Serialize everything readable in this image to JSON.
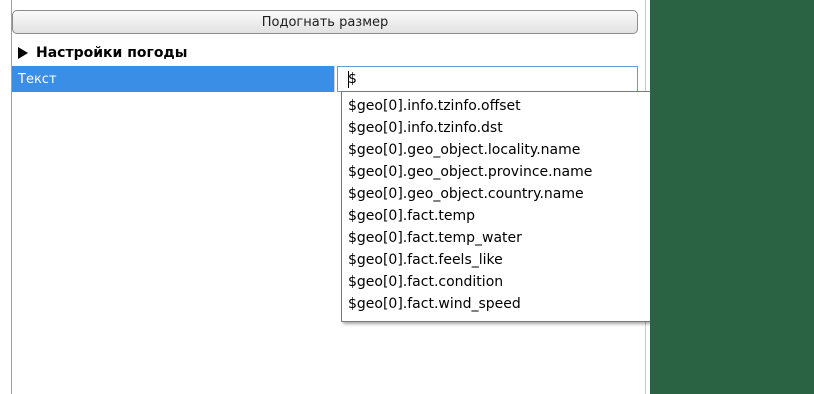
{
  "toolbar": {
    "fit_size_label": "Подогнать размер"
  },
  "section": {
    "title": "Настройки погоды"
  },
  "property": {
    "label": "Текст",
    "value": "$"
  },
  "autocomplete": {
    "items": [
      "$geo[0].info.tzinfo.offset",
      "$geo[0].info.tzinfo.dst",
      "$geo[0].geo_object.locality.name",
      "$geo[0].geo_object.province.name",
      "$geo[0].geo_object.country.name",
      "$geo[0].fact.temp",
      "$geo[0].fact.temp_water",
      "$geo[0].fact.feels_like",
      "$geo[0].fact.condition",
      "$geo[0].fact.wind_speed"
    ]
  },
  "colors": {
    "selection": "#3a8ee6",
    "canvas": "#2a6344"
  }
}
